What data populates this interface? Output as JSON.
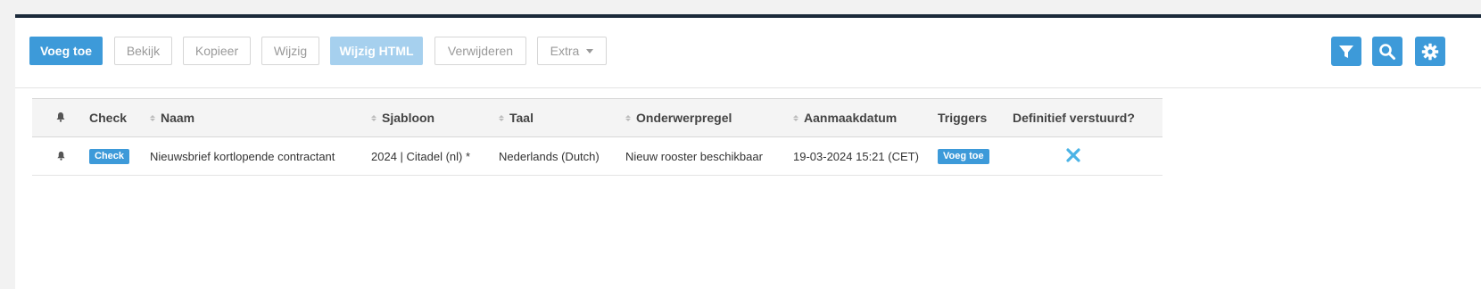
{
  "toolbar": {
    "add": "Voeg toe",
    "view": "Bekijk",
    "copy": "Kopieer",
    "edit": "Wijzig",
    "edit_html": "Wijzig HTML",
    "delete": "Verwijderen",
    "extra": "Extra"
  },
  "actions": [
    "filter-icon",
    "search-icon",
    "gear-icon"
  ],
  "colors": {
    "accent": "#3d9ad9",
    "accent_disabled": "#a6d0ee",
    "header_bar": "#1b2a3a"
  },
  "table": {
    "headers": {
      "bell": "bell-icon",
      "check": "Check",
      "name": "Naam",
      "template": "Sjabloon",
      "language": "Taal",
      "subject": "Onderwerpregel",
      "created": "Aanmaakdatum",
      "triggers": "Triggers",
      "sent": "Definitief verstuurd?"
    },
    "rows": [
      {
        "check": "Check",
        "name": "Nieuwsbrief kortlopende contractant",
        "template": "2024 | Citadel (nl) *",
        "language": "Nederlands (Dutch)",
        "subject": "Nieuw rooster beschikbaar",
        "created": "19-03-2024 15:21 (CET)",
        "triggers": "Voeg toe",
        "sent": "false"
      }
    ]
  }
}
